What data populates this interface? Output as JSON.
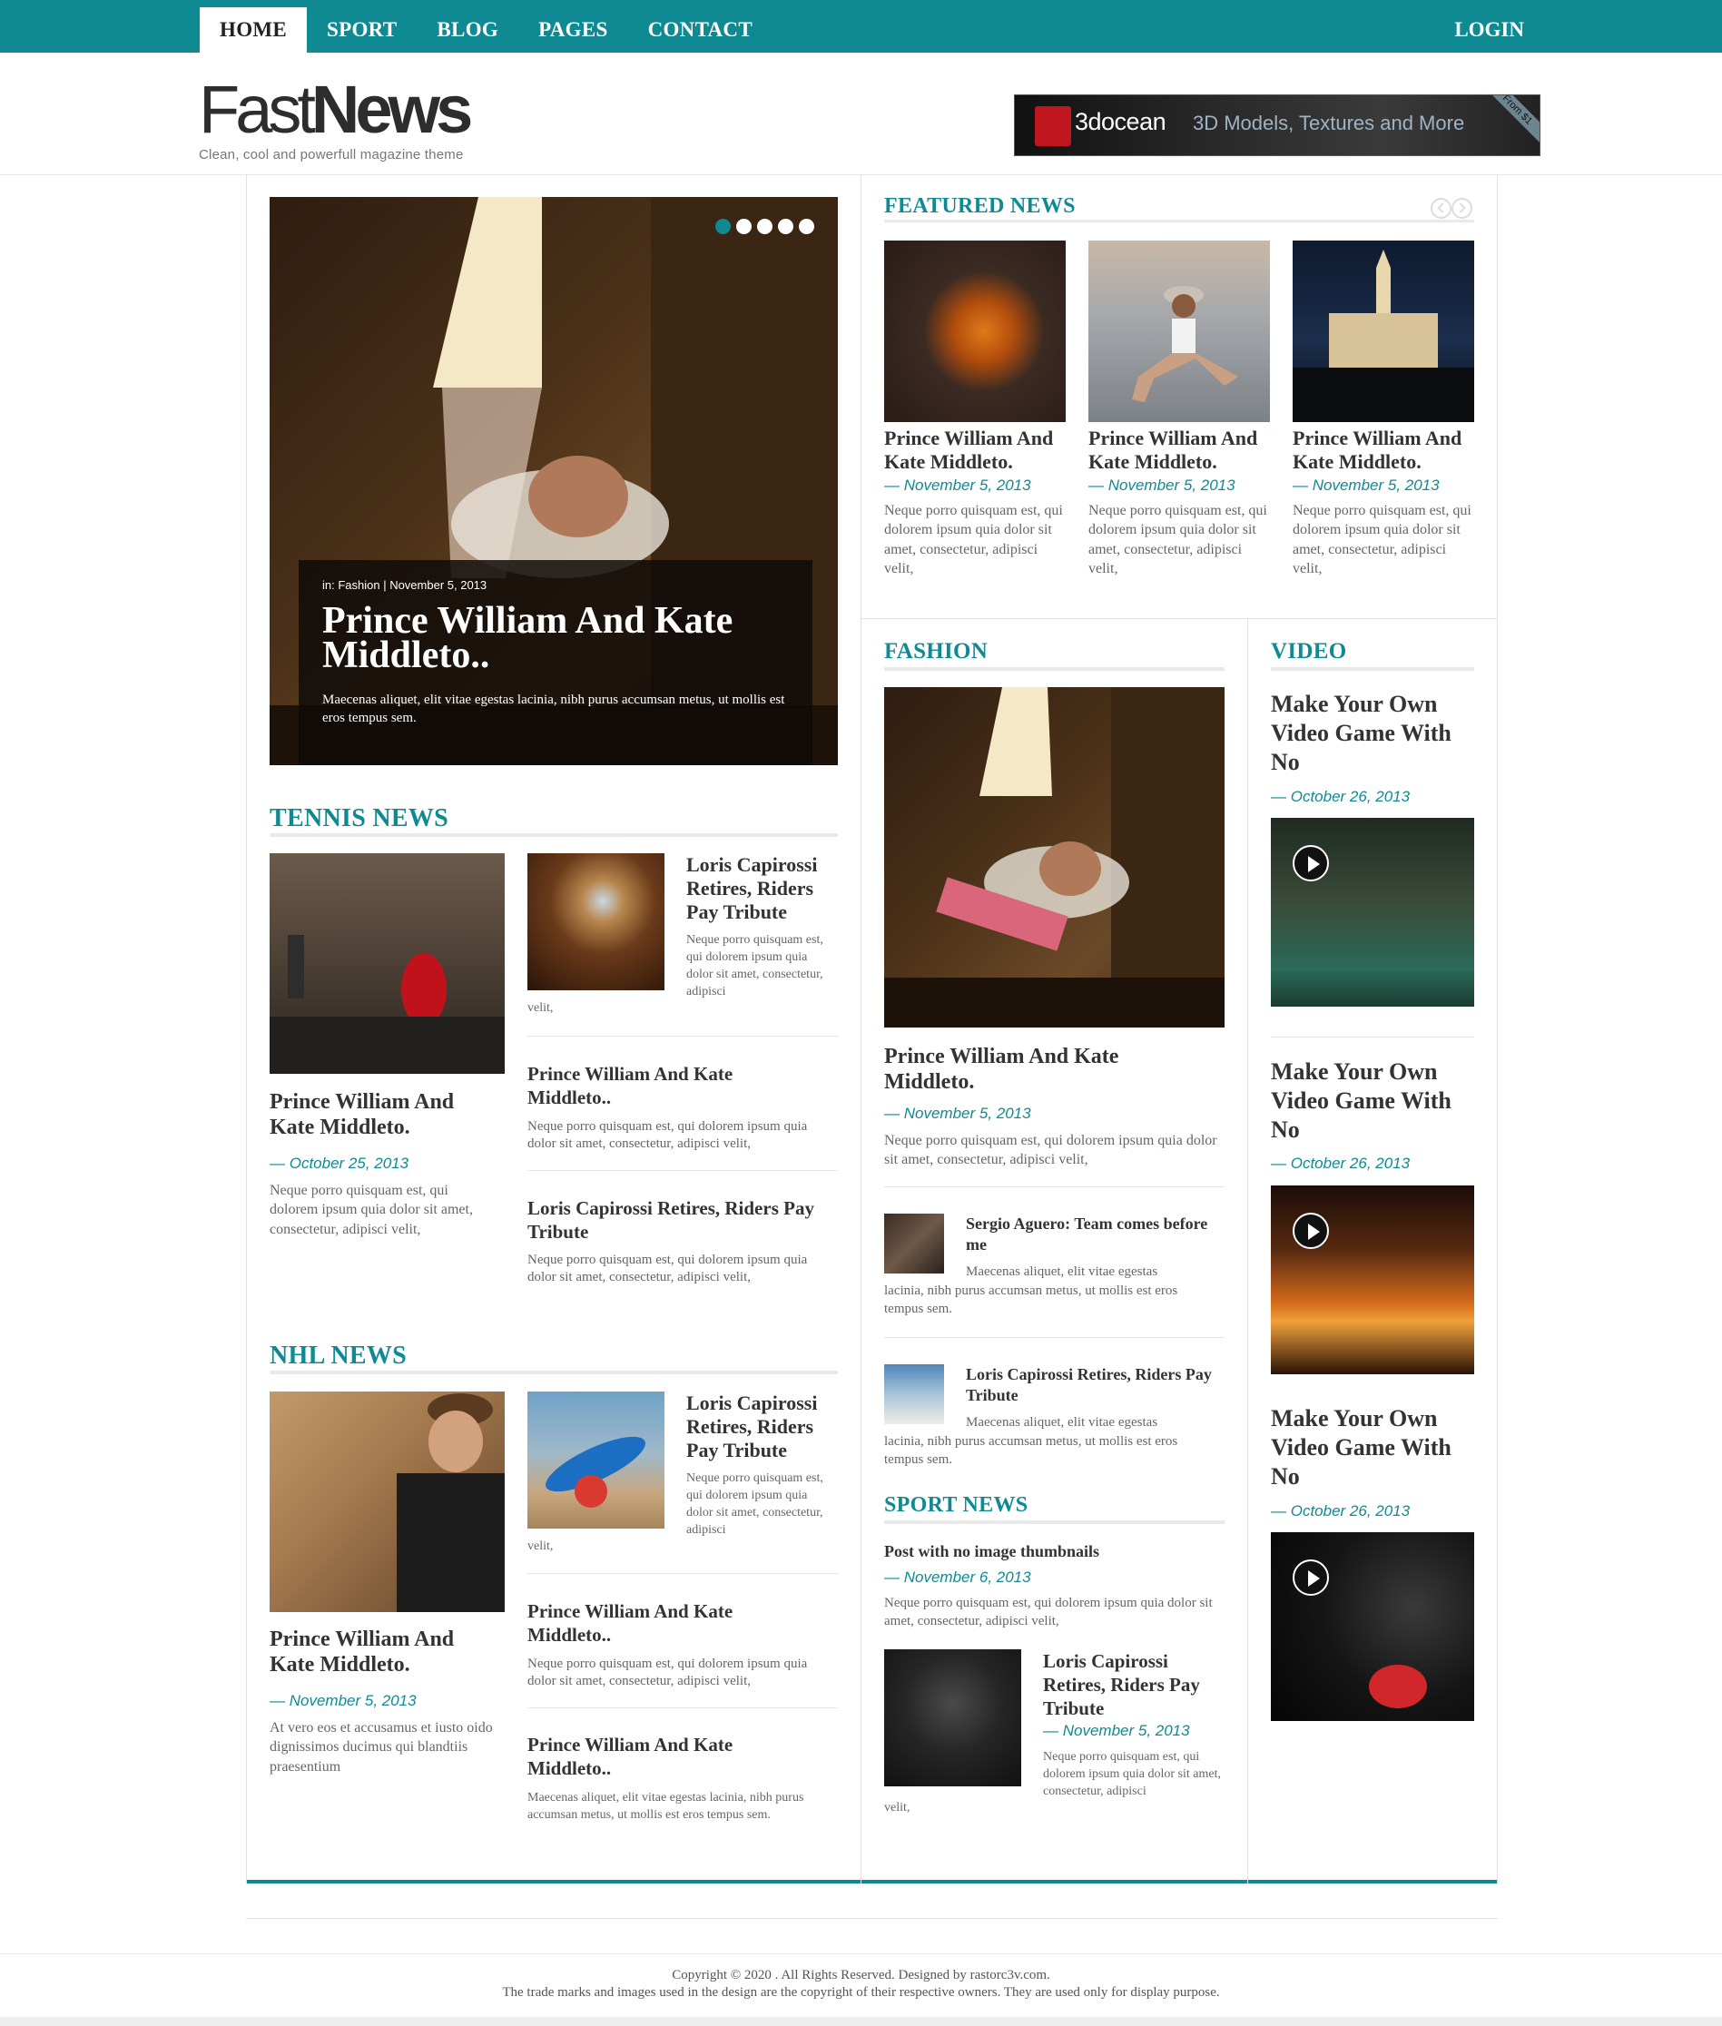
{
  "nav": {
    "items": [
      "HOME",
      "SPORT",
      "BLOG",
      "PAGES",
      "CONTACT"
    ],
    "login": "LOGIN"
  },
  "header": {
    "logo_fast": "Fast",
    "logo_news": "News",
    "tagline": "Clean, cool  and powerfull  magazine theme",
    "ad_brand": "3docean",
    "ad_slogan": "3D Models, Textures and More",
    "ad_ribbon": "From $1"
  },
  "slider": {
    "meta": "in: Fashion | November 5, 2013",
    "title": "Prince William And Kate Middleto..",
    "excerpt": "Maecenas aliquet, elit vitae egestas lacinia, nibh purus accumsan metus, ut mollis est eros tempus sem."
  },
  "featured": {
    "heading": "FEATURED NEWS",
    "items": [
      {
        "title": "Prince William And Kate Middleto.",
        "date": "— November 5, 2013",
        "excerpt": "Neque porro quisquam est, qui dolorem ipsum quia dolor sit amet, consectetur, adipisci velit,"
      },
      {
        "title": "Prince William And Kate Middleto.",
        "date": "— November 5, 2013",
        "excerpt": "Neque porro quisquam est, qui dolorem ipsum quia dolor sit amet, consectetur, adipisci velit,"
      },
      {
        "title": "Prince William And Kate Middleto.",
        "date": "— November 5, 2013",
        "excerpt": "Neque porro quisquam est, qui dolorem ipsum quia dolor sit amet, consectetur, adipisci velit,"
      }
    ]
  },
  "tennis": {
    "heading": "TENNIS NEWS",
    "main": {
      "title": "Prince William And Kate Middleto.",
      "date": "— October 25, 2013",
      "excerpt": "Neque porro quisquam est, qui dolorem ipsum quia dolor sit amet, consectetur, adipisci velit,"
    },
    "side1": {
      "title": "Loris Capirossi Retires, Riders Pay Tribute",
      "excerpt": "Neque porro quisquam est, qui dolorem ipsum quia dolor sit amet, consectetur, adipisci",
      "tail": "velit,"
    },
    "side2": {
      "title": "Prince William And Kate Middleto..",
      "excerpt": "Neque porro quisquam est, qui dolorem ipsum quia dolor sit amet, consectetur, adipisci velit,"
    },
    "side3": {
      "title": "Loris Capirossi Retires, Riders Pay Tribute",
      "excerpt": "Neque porro quisquam est, qui dolorem ipsum quia dolor sit amet, consectetur, adipisci velit,"
    }
  },
  "nhl": {
    "heading": "NHL NEWS",
    "main": {
      "title": "Prince William And Kate Middleto.",
      "date": "— November 5, 2013",
      "excerpt": "At vero eos et accusamus et iusto oido dignissimos ducimus qui blandtiis praesentium"
    },
    "side1": {
      "title": "Loris Capirossi Retires, Riders Pay Tribute",
      "excerpt": "Neque porro quisquam est, qui dolorem ipsum quia dolor sit amet, consectetur, adipisci",
      "tail": "velit,"
    },
    "side2": {
      "title": "Prince William And Kate Middleto..",
      "excerpt": "Neque porro quisquam est, qui dolorem ipsum quia dolor sit amet, consectetur, adipisci velit,"
    },
    "side3": {
      "title": "Prince William And Kate Middleto..",
      "excerpt": "Maecenas aliquet, elit vitae egestas lacinia, nibh purus accumsan metus, ut mollis est eros tempus sem."
    }
  },
  "fashion": {
    "heading": "FASHION",
    "main": {
      "title": "Prince William And Kate Middleto.",
      "date": "— November 5, 2013",
      "excerpt": "Neque porro quisquam est, qui dolorem ipsum quia dolor sit amet, consectetur, adipisci velit,"
    },
    "item1": {
      "title": "Sergio Aguero: Team comes before me",
      "excerpt": "Maecenas aliquet, elit vitae egestas",
      "tail": "lacinia, nibh purus accumsan metus, ut mollis est eros tempus sem."
    },
    "item2": {
      "title": "Loris Capirossi Retires, Riders Pay Tribute",
      "excerpt": "Maecenas aliquet, elit vitae egestas",
      "tail": "lacinia, nibh purus accumsan metus, ut mollis est eros tempus sem."
    }
  },
  "sport": {
    "heading": "SPORT NEWS",
    "post1": {
      "title": "Post with no image thumbnails",
      "date": "— November 6, 2013",
      "excerpt": "Neque porro quisquam est, qui dolorem ipsum quia dolor sit amet, consectetur, adipisci velit,"
    },
    "post2": {
      "title": "Loris Capirossi Retires, Riders Pay Tribute",
      "date": "— November 5, 2013",
      "excerpt": "Neque porro quisquam est, qui dolorem ipsum quia dolor sit amet, consectetur, adipisci",
      "tail": "velit,"
    }
  },
  "video": {
    "heading": "VIDEO",
    "items": [
      {
        "title": "Make Your Own Video Game With No",
        "date": "— October 26, 2013"
      },
      {
        "title": "Make Your Own Video Game With No",
        "date": "— October 26, 2013"
      },
      {
        "title": "Make Your Own Video Game With No",
        "date": "— October 26, 2013"
      }
    ]
  },
  "footer": {
    "line1": "Copyright © 2020 . All Rights Reserved. Designed by rastorc3v.com.",
    "line2": "The trade marks and images used in the design are the copyright of their respective owners. They are used only for display purpose."
  },
  "colors": {
    "accent": "#0f8a93",
    "text": "#333333",
    "muted": "#666666"
  }
}
